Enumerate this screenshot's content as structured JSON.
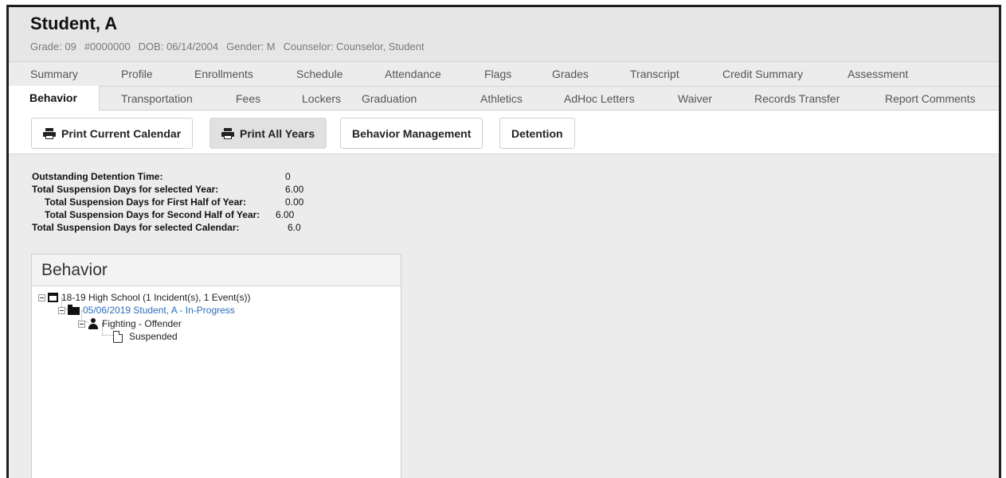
{
  "student": {
    "name": "Student, A",
    "grade": "Grade: 09",
    "id": "#0000000",
    "dob": "DOB: 06/14/2004",
    "gender": "Gender: M",
    "counselor": "Counselor: Counselor, Student"
  },
  "tabs_row1": [
    "Summary",
    "Profile",
    "Enrollments",
    "Schedule",
    "Attendance",
    "Flags",
    "Grades",
    "Transcript",
    "Credit Summary",
    "Assessment"
  ],
  "tabs_row2": [
    "Behavior",
    "Transportation",
    "Fees",
    "Lockers",
    "Graduation",
    "Athletics",
    "AdHoc Letters",
    "Waiver",
    "Records Transfer",
    "Report Comments"
  ],
  "toolbar": {
    "print_current": "Print Current Calendar",
    "print_all": "Print All Years",
    "behavior_mgmt": "Behavior Management",
    "detention": "Detention"
  },
  "stats": [
    {
      "label": "Outstanding Detention Time:",
      "value": "0"
    },
    {
      "label": "Total Suspension Days for selected Year:",
      "value": "6.00"
    },
    {
      "label": "Total Suspension Days for First Half of Year:",
      "value": "0.00"
    },
    {
      "label": "Total Suspension Days for Second Half of Year:",
      "value": "6.00"
    },
    {
      "label": "Total Suspension Days for selected Calendar:",
      "value": "6.0"
    }
  ],
  "behavior_panel": {
    "title": "Behavior",
    "tree": {
      "calendar": "18-19 High School (1 Incident(s), 1 Event(s))",
      "incident": "05/06/2019 Student, A - In-Progress",
      "event": "Fighting - Offender",
      "resolution": "Suspended"
    }
  },
  "colors": {
    "link": "#2a6ebb",
    "header_bg": "#e6e6e6"
  }
}
